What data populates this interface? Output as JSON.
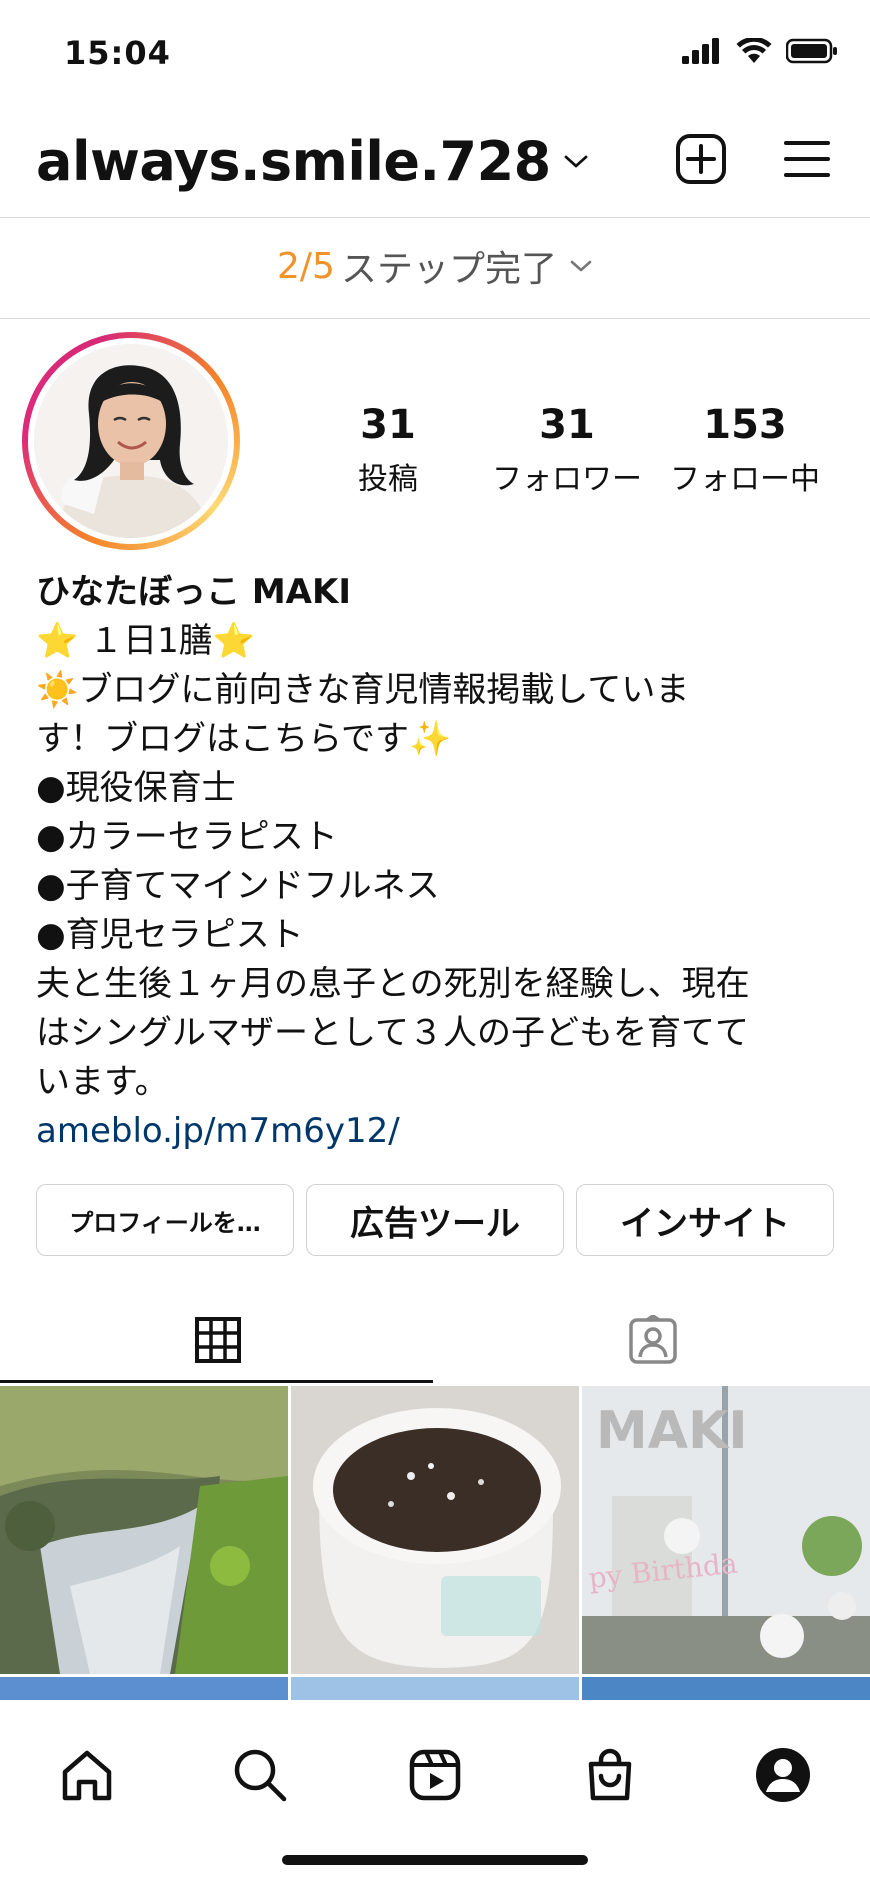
{
  "status_bar": {
    "time": "15:04"
  },
  "header": {
    "username": "always.smile.728"
  },
  "steps": {
    "progress": "2/5",
    "label": "ステップ完了"
  },
  "stats": [
    {
      "value": "31",
      "label": "投稿"
    },
    {
      "value": "31",
      "label": "フォロワー"
    },
    {
      "value": "153",
      "label": "フォロー中"
    }
  ],
  "bio": {
    "name": "ひなたぼっこ MAKI",
    "lines": [
      "⭐ １日1膳⭐",
      "☀️ブログに前向きな育児情報掲載していま",
      "す！ブログはこちらです✨",
      "●現役保育士",
      "●カラーセラピスト",
      "●子育てマインドフルネス",
      "●育児セラピスト",
      "夫と生後１ヶ月の息子との死別を経験し、現在",
      "はシングルマザーとして３人の子どもを育てて",
      "います。"
    ],
    "link": "ameblo.jp/m7m6y12/"
  },
  "buttons": {
    "edit_profile": "プロフィールを…",
    "ad_tools": "広告ツール",
    "insights": "インサイト"
  },
  "posts": {
    "balloon_letters": "MAKI",
    "banner_text": "py Birthda"
  },
  "colors": {
    "accent_orange": "#f0932b",
    "link_blue": "#00376b",
    "border": "#dbdbdb"
  }
}
